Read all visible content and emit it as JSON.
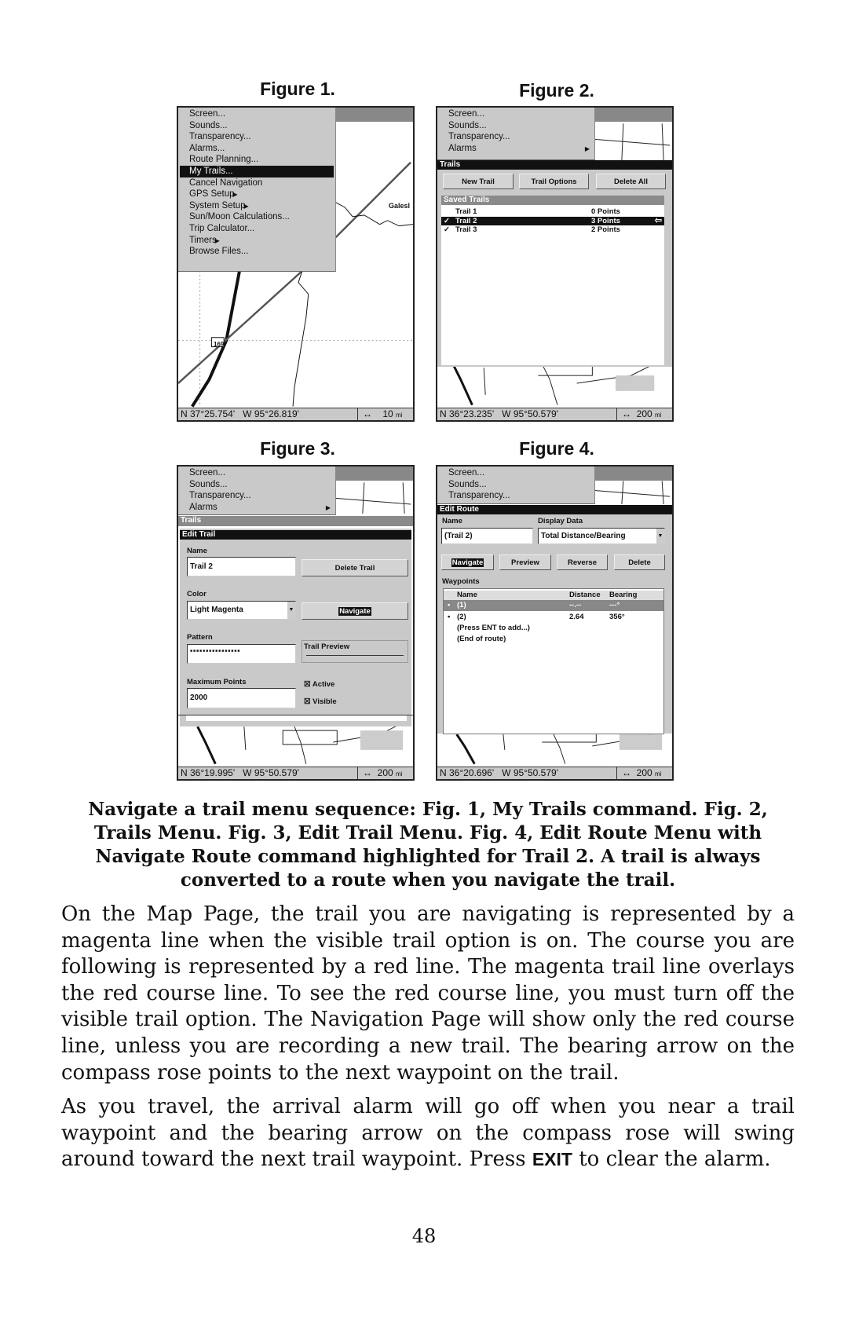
{
  "figures": [
    {
      "label": "Figure 1.",
      "menu": [
        {
          "label": "Screen...",
          "arrow": false
        },
        {
          "label": "Sounds...",
          "arrow": false
        },
        {
          "label": "Transparency...",
          "arrow": false
        },
        {
          "label": "Alarms...",
          "arrow": false
        },
        {
          "label": "Route Planning...",
          "arrow": false
        },
        {
          "label": "My Trails...",
          "arrow": false,
          "selected": true
        },
        {
          "label": "Cancel Navigation",
          "arrow": false
        },
        {
          "label": "GPS Setup",
          "arrow": true
        },
        {
          "label": "System Setup",
          "arrow": true
        },
        {
          "label": "Sun/Moon Calculations...",
          "arrow": false
        },
        {
          "label": "Trip Calculator...",
          "arrow": false
        },
        {
          "label": "Timers",
          "arrow": true
        },
        {
          "label": "Browse Files...",
          "arrow": false
        }
      ],
      "map_label": "Galesl",
      "highway_shield": "169",
      "status": {
        "lat": "N   37°25.754'",
        "lon": "W   95°26.819'",
        "scale": "10",
        "unit": "mi"
      }
    },
    {
      "label": "Figure 2.",
      "menu": [
        {
          "label": "Screen..."
        },
        {
          "label": "Sounds..."
        },
        {
          "label": "Transparency..."
        },
        {
          "label": "Alarms",
          "arrow": true
        }
      ],
      "dialog_title": "Trails",
      "buttons": [
        "New Trail",
        "Trail Options",
        "Delete All"
      ],
      "list_header": "Saved Trails",
      "trails": [
        {
          "check": "",
          "name": "Trail 1",
          "points": "0 Points",
          "selected": false
        },
        {
          "check": "✓",
          "name": "Trail 2",
          "points": "3 Points",
          "selected": true
        },
        {
          "check": "✓",
          "name": "Trail 3",
          "points": "2 Points",
          "selected": false
        }
      ],
      "status": {
        "lat": "N   36°23.235'",
        "lon": "W   95°50.579'",
        "scale": "200",
        "unit": "mi"
      }
    },
    {
      "label": "Figure 3.",
      "menu": [
        {
          "label": "Screen..."
        },
        {
          "label": "Sounds..."
        },
        {
          "label": "Transparency..."
        },
        {
          "label": "Alarms",
          "arrow": true
        }
      ],
      "parent_title": "Trails",
      "dialog_title": "Edit Trail",
      "name_label": "Name",
      "name_value": "Trail 2",
      "delete_button": "Delete Trail",
      "color_label": "Color",
      "color_value": "Light Magenta",
      "navigate_button": "Navigate",
      "pattern_label": "Pattern",
      "pattern_value": "■■■■■■■■■■■■■■■■",
      "preview_label": "Trail Preview",
      "max_points_label": "Maximum Points",
      "max_points_value": "2000",
      "active_label": "Active",
      "active_checked": true,
      "visible_label": "Visible",
      "visible_checked": true,
      "status": {
        "lat": "N   36°19.995'",
        "lon": "W   95°50.579'",
        "scale": "200",
        "unit": "mi"
      }
    },
    {
      "label": "Figure 4.",
      "menu": [
        {
          "label": "Screen..."
        },
        {
          "label": "Sounds..."
        },
        {
          "label": "Transparency..."
        }
      ],
      "dialog_title": "Edit Route",
      "name_label": "Name",
      "name_value": "(Trail 2)",
      "display_label": "Display Data",
      "display_value": "Total Distance/Bearing",
      "buttons": [
        "Navigate",
        "Preview",
        "Reverse",
        "Delete"
      ],
      "waypoints_label": "Waypoints",
      "columns": [
        "Name",
        "Distance",
        "Bearing"
      ],
      "waypoints": [
        {
          "name": "(1)",
          "distance": "--.--",
          "bearing": "---°",
          "selected": true
        },
        {
          "name": "(2)",
          "distance": "2.64",
          "bearing": "356°",
          "selected": false
        }
      ],
      "hints": [
        "(Press ENT to add...)",
        "(End of route)"
      ],
      "status": {
        "lat": "N   36°20.696'",
        "lon": "W   95°50.579'",
        "scale": "200",
        "unit": "mi"
      }
    }
  ],
  "caption": "Navigate a trail menu sequence: Fig. 1, My Trails command. Fig. 2, Trails Menu. Fig. 3, Edit Trail Menu. Fig. 4, Edit Route Menu with Navigate Route command highlighted for Trail 2. A trail is always converted to a route when you navigate the trail.",
  "paragraph1": "On the Map Page, the trail you are navigating is represented by a magenta line when the visible trail option is on. The course you are following is represented by a red line. The magenta trail line overlays the red course line. To see the red course line, you must turn off the visible trail option. The Navigation Page will show only the red course line, unless you are recording a new trail. The bearing arrow on the compass rose points to the next waypoint on the trail.",
  "paragraph2_before": "As you travel, the arrival alarm will go off when you near a trail waypoint and the bearing arrow on the compass rose will swing around toward the next trail waypoint. Press ",
  "paragraph2_key": "EXIT",
  "paragraph2_after": " to clear the alarm.",
  "page_number": "48",
  "icons": {
    "submenu": "triangle-right-icon",
    "scale": "double-arrow-icon",
    "dropdown": "chevron-down-icon",
    "pointer": "hand-arrow-icon"
  }
}
